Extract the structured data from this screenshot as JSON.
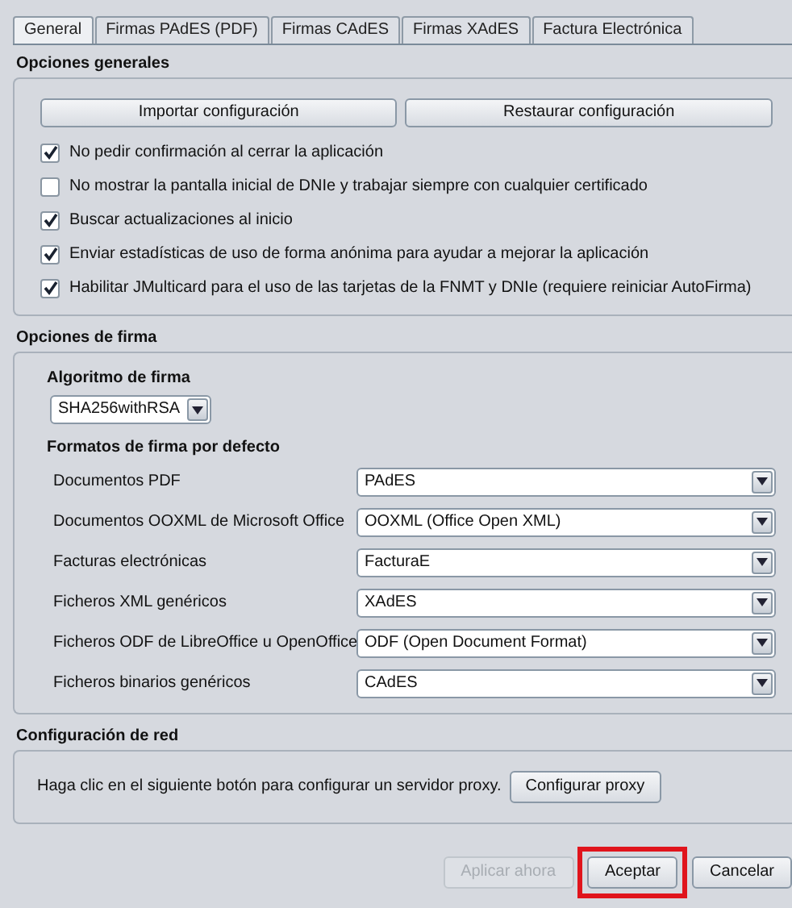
{
  "tabs": [
    {
      "label": "General",
      "selected": true
    },
    {
      "label": "Firmas PAdES (PDF)",
      "selected": false
    },
    {
      "label": "Firmas CAdES",
      "selected": false
    },
    {
      "label": "Firmas XAdES",
      "selected": false
    },
    {
      "label": "Factura Electrónica",
      "selected": false
    }
  ],
  "general_options": {
    "title": "Opciones generales",
    "buttons": [
      "Importar configuración",
      "Restaurar configuración"
    ],
    "checkboxes": [
      {
        "label": "No pedir confirmación al cerrar la aplicación",
        "checked": true
      },
      {
        "label": "No mostrar la pantalla inicial de DNIe y trabajar siempre con cualquier certificado",
        "checked": false
      },
      {
        "label": "Buscar actualizaciones al inicio",
        "checked": true
      },
      {
        "label": "Enviar estadísticas de uso de forma anónima para ayudar a mejorar la aplicación",
        "checked": true
      },
      {
        "label": "Habilitar JMulticard para el uso de las tarjetas de la FNMT y DNIe (requiere reiniciar AutoFirma)",
        "checked": true
      }
    ]
  },
  "signature_options": {
    "title": "Opciones de firma",
    "algorithm_label": "Algoritmo de firma",
    "algorithm_value": "SHA256withRSA",
    "formats_label": "Formatos de firma por defecto",
    "formats": [
      {
        "label": "Documentos PDF",
        "value": "PAdES"
      },
      {
        "label": "Documentos OOXML de Microsoft Office",
        "value": "OOXML (Office Open XML)"
      },
      {
        "label": "Facturas electrónicas",
        "value": "FacturaE"
      },
      {
        "label": "Ficheros XML genéricos",
        "value": "XAdES"
      },
      {
        "label": "Ficheros ODF de LibreOffice u OpenOffice",
        "value": "ODF (Open Document Format)"
      },
      {
        "label": "Ficheros binarios genéricos",
        "value": "CAdES"
      }
    ]
  },
  "network": {
    "title": "Configuración de red",
    "text": "Haga clic en el siguiente botón para configurar un servidor proxy.",
    "button": "Configurar proxy"
  },
  "footer_buttons": [
    {
      "label": "Aplicar ahora",
      "disabled": true,
      "highlighted": false
    },
    {
      "label": "Aceptar",
      "disabled": false,
      "highlighted": true
    },
    {
      "label": "Cancelar",
      "disabled": false,
      "highlighted": false
    }
  ]
}
